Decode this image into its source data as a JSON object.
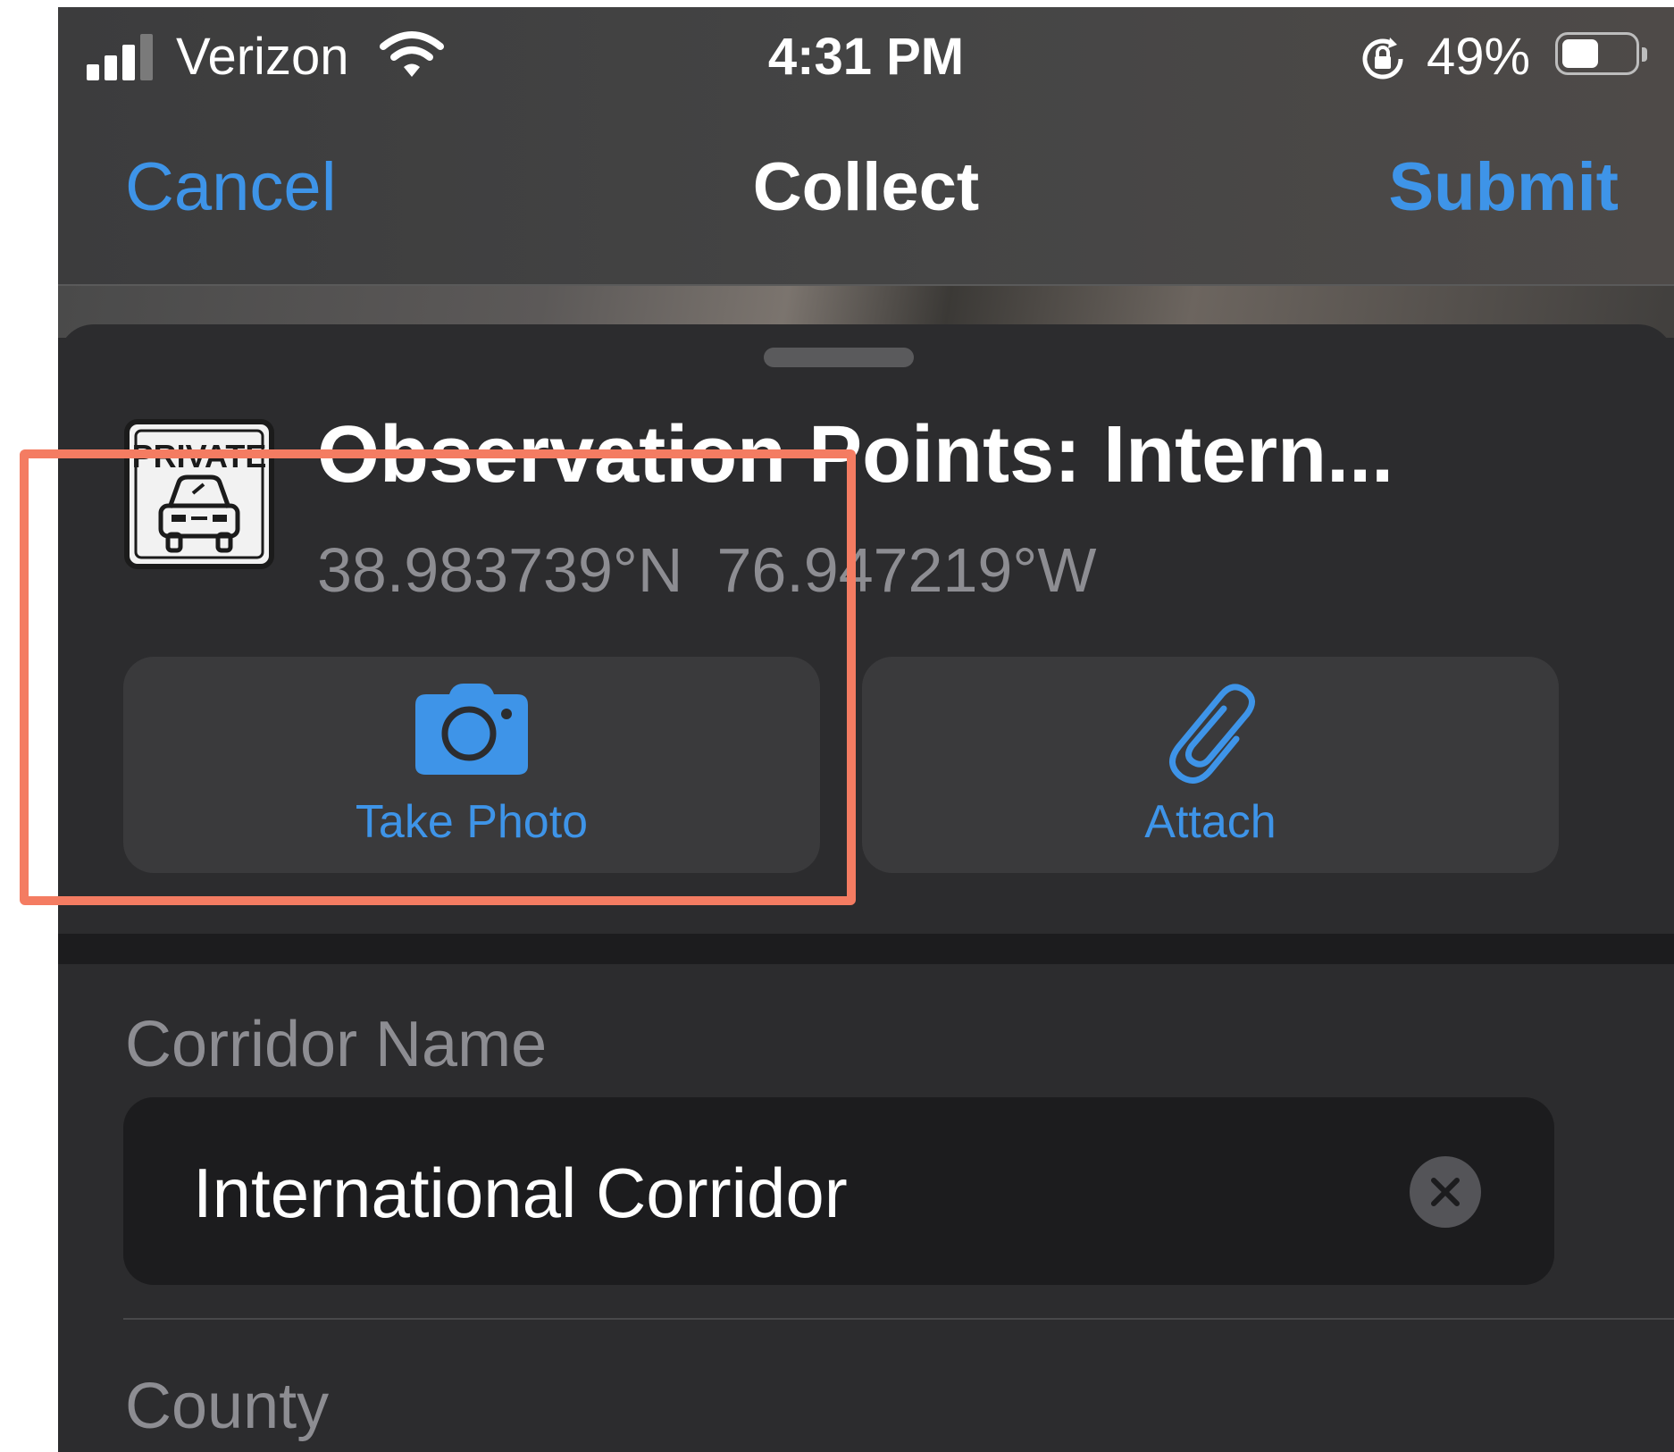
{
  "status_bar": {
    "carrier": "Verizon",
    "time": "4:31 PM",
    "battery_percent": "49%",
    "battery_level": 0.49,
    "icons": [
      "cellular-signal-icon",
      "wifi-icon",
      "orientation-lock-icon",
      "battery-icon"
    ]
  },
  "nav": {
    "cancel_label": "Cancel",
    "title": "Collect",
    "submit_label": "Submit"
  },
  "layer": {
    "icon_text": "PRIVATE",
    "icon_name": "private-vehicle-sign-icon",
    "title": "Observation Points: Intern...",
    "latitude": "38.983739°N",
    "longitude": "76.947219°W"
  },
  "actions": {
    "take_photo_label": "Take Photo",
    "take_photo_icon": "camera-icon",
    "attach_label": "Attach",
    "attach_icon": "paperclip-icon"
  },
  "fields": {
    "corridor_label": "Corridor Name",
    "corridor_value": "International Corridor",
    "county_label": "County"
  },
  "colors": {
    "accent": "#3e94e8",
    "highlight": "#f47c62",
    "sheet": "#2c2c2e"
  }
}
